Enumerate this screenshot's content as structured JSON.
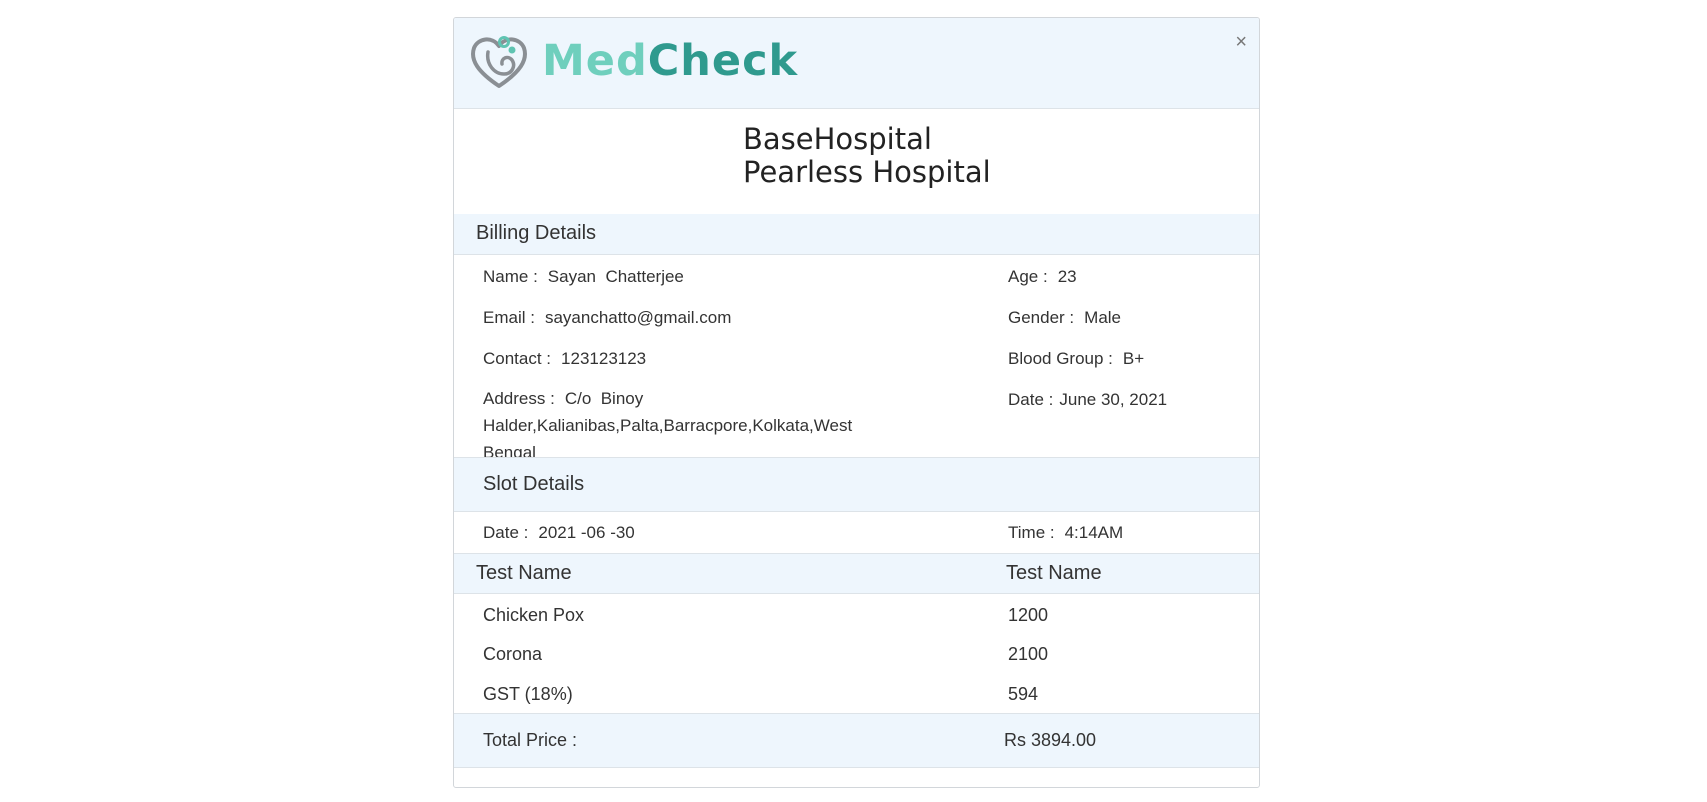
{
  "logo": {
    "part1": "Med",
    "part2": "Check"
  },
  "close_label": "×",
  "hospital": {
    "line1": "BaseHospital",
    "line2": "Pearless Hospital"
  },
  "billing": {
    "title": "Billing Details",
    "name_label": "Name :",
    "name_value": "Sayan  Chatterjee",
    "email_label": "Email :",
    "email_value": "sayanchatto@gmail.com",
    "contact_label": "Contact :",
    "contact_value": "123123123",
    "address_label": "Address :",
    "address_value": "C/o  Binoy Halder,Kalianibas,Palta,Barracpore,Kolkata,West Bengal",
    "age_label": "Age :",
    "age_value": "23",
    "gender_label": "Gender :",
    "gender_value": "Male",
    "blood_label": "Blood Group :",
    "blood_value": "B+",
    "date_label": "Date :",
    "date_value": "June 30, 2021"
  },
  "slot": {
    "title": "Slot Details",
    "date_label": "Date :",
    "date_value": "2021 -06 -30",
    "time_label": "Time :",
    "time_value": "4:14AM"
  },
  "tests": {
    "col1": "Test Name",
    "col2": "Test Name",
    "rows": [
      {
        "name": "Chicken Pox",
        "price": "1200"
      },
      {
        "name": "Corona",
        "price": "2100"
      },
      {
        "name": "GST (18%)",
        "price": "594"
      }
    ]
  },
  "total": {
    "label": "Total Price :",
    "value": "Rs 3894.00"
  }
}
